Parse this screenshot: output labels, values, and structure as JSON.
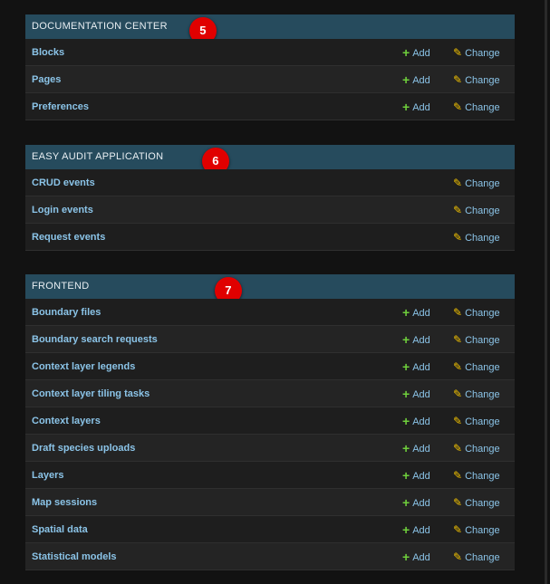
{
  "sections": [
    {
      "title": "DOCUMENTATION CENTER",
      "badge": "5",
      "rows": [
        {
          "name": "Blocks",
          "add": "Add",
          "change": "Change"
        },
        {
          "name": "Pages",
          "add": "Add",
          "change": "Change"
        },
        {
          "name": "Preferences",
          "add": "Add",
          "change": "Change"
        }
      ]
    },
    {
      "title": "EASY AUDIT APPLICATION",
      "badge": "6",
      "rows": [
        {
          "name": "CRUD events",
          "change": "Change"
        },
        {
          "name": "Login events",
          "change": "Change"
        },
        {
          "name": "Request events",
          "change": "Change"
        }
      ]
    },
    {
      "title": "FRONTEND",
      "badge": "7",
      "rows": [
        {
          "name": "Boundary files",
          "add": "Add",
          "change": "Change"
        },
        {
          "name": "Boundary search requests",
          "add": "Add",
          "change": "Change"
        },
        {
          "name": "Context layer legends",
          "add": "Add",
          "change": "Change"
        },
        {
          "name": "Context layer tiling tasks",
          "add": "Add",
          "change": "Change"
        },
        {
          "name": "Context layers",
          "add": "Add",
          "change": "Change"
        },
        {
          "name": "Draft species uploads",
          "add": "Add",
          "change": "Change"
        },
        {
          "name": "Layers",
          "add": "Add",
          "change": "Change"
        },
        {
          "name": "Map sessions",
          "add": "Add",
          "change": "Change"
        },
        {
          "name": "Spatial data",
          "add": "Add",
          "change": "Change"
        },
        {
          "name": "Statistical models",
          "add": "Add",
          "change": "Change"
        }
      ]
    }
  ],
  "icons": {
    "add": "plus-icon",
    "change": "pencil-icon"
  },
  "colors": {
    "header_bg": "#264b5d",
    "link": "#8bc4e8",
    "add_icon": "#6fcf3c",
    "change_icon": "#f2c200",
    "badge": "#e00000"
  }
}
